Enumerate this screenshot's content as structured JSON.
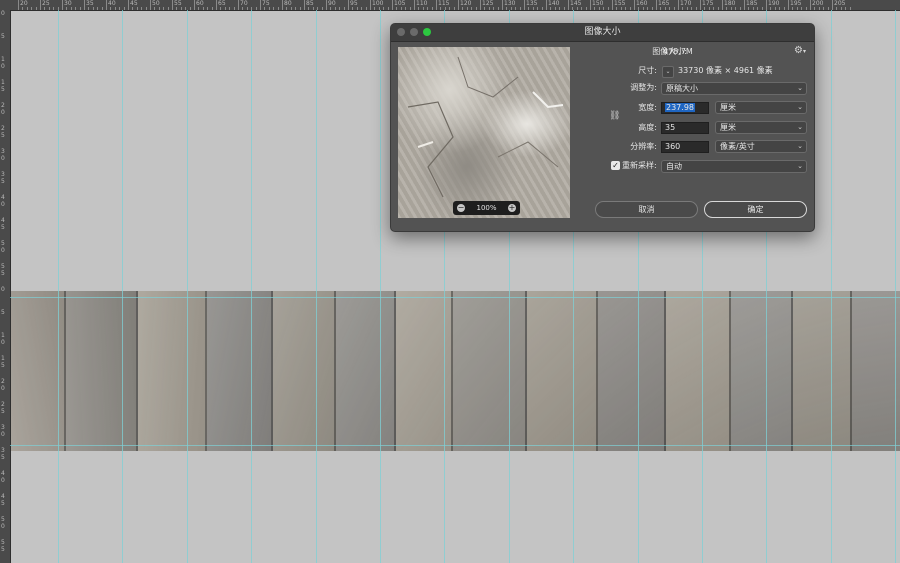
{
  "ruler_top": {
    "labels": [
      "20",
      "25",
      "30",
      "35",
      "40",
      "45",
      "50",
      "55",
      "60",
      "65",
      "70",
      "75",
      "80",
      "85",
      "90",
      "95",
      "100",
      "105",
      "110",
      "115",
      "120",
      "125",
      "130",
      "135",
      "140",
      "145",
      "150",
      "155",
      "160",
      "165",
      "170",
      "175",
      "180",
      "185",
      "190",
      "195",
      "200",
      "205"
    ]
  },
  "ruler_left": {
    "labels": [
      "0",
      "5",
      "1 0",
      "1 5",
      "2 0",
      "2 5",
      "3 0",
      "3 5",
      "4 0",
      "4 5",
      "5 0",
      "5 5",
      "0",
      "5",
      "1 0",
      "1 5",
      "2 0",
      "2 5",
      "3 0",
      "3 5",
      "4 0",
      "4 5",
      "5 0",
      "5 5"
    ]
  },
  "dialog": {
    "title": "图像大小",
    "image_size_label": "图像大小:",
    "image_size_value": "478.7M",
    "gear_icon": "gear-icon",
    "dimensions_label": "尺寸:",
    "dimensions_value": "33730 像素  ×  4961 像素",
    "fit_to_label": "调整为:",
    "fit_to_value": "原稿大小",
    "width_label": "宽度:",
    "width_value": "237.98",
    "width_unit": "厘米",
    "height_label": "高度:",
    "height_value": "35",
    "height_unit": "厘米",
    "resolution_label": "分辨率:",
    "resolution_value": "360",
    "resolution_unit": "像素/英寸",
    "resample_label": "重新采样:",
    "resample_checked": true,
    "resample_value": "自动",
    "link_icon": "link-icon",
    "zoom_label": "100%",
    "cancel_label": "取消",
    "ok_label": "确定",
    "traffic_colors": [
      "#6a6a6a",
      "#6a6a6a",
      "#2cc840"
    ],
    "selection_color": "#1f66c2"
  }
}
